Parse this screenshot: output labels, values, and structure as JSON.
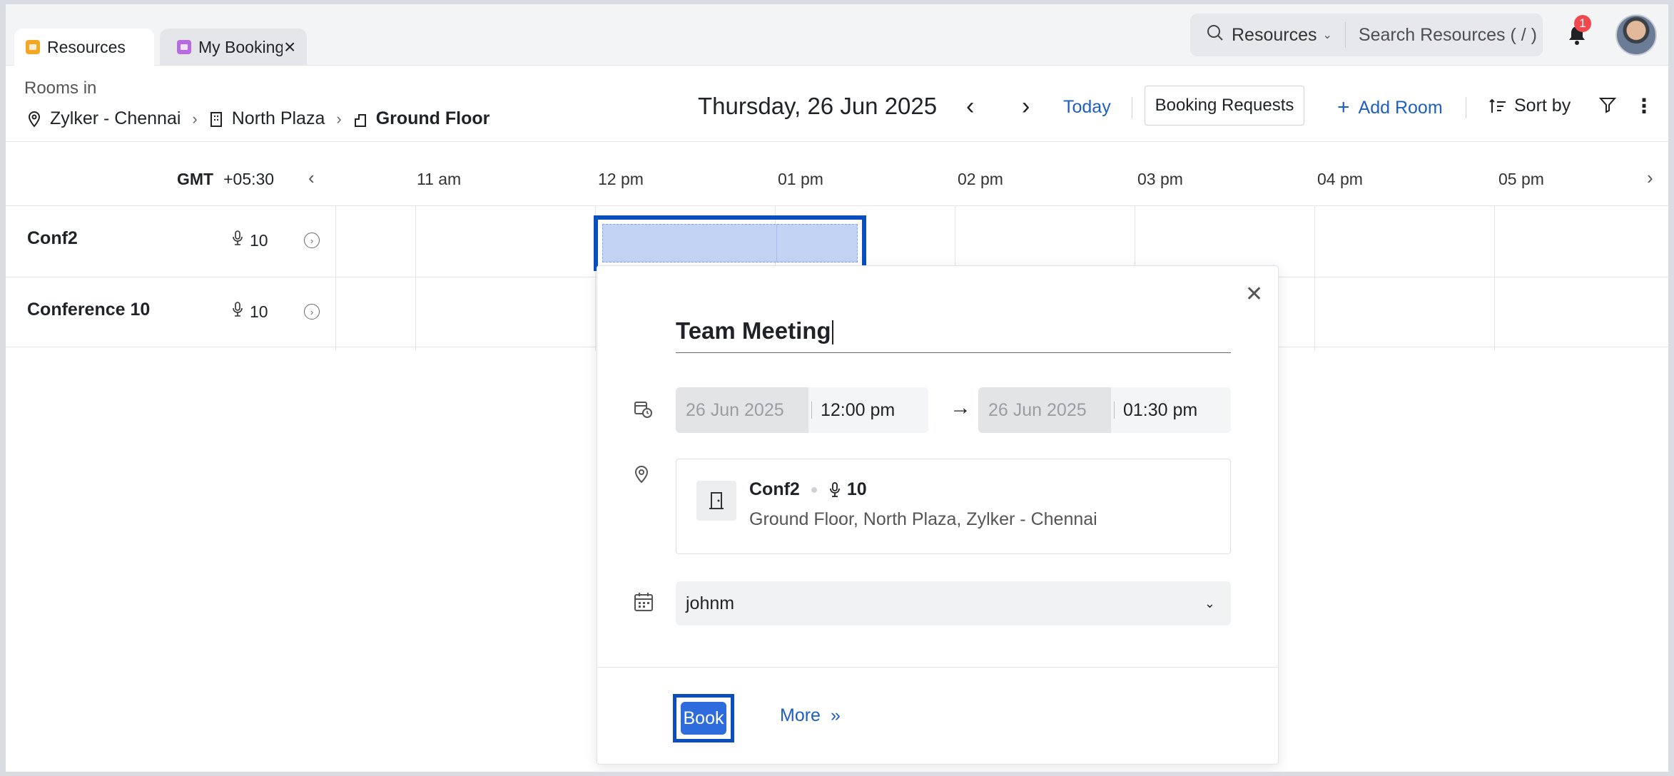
{
  "tabs": [
    {
      "label": "Resources",
      "active": true
    },
    {
      "label": "My Bookings",
      "active": false
    }
  ],
  "search": {
    "scope": "Resources",
    "placeholder": "Search Resources ( / )"
  },
  "notifications": {
    "count": "1"
  },
  "header": {
    "rooms_in": "Rooms in",
    "breadcrumb": [
      "Zylker - Chennai",
      "North Plaza",
      "Ground Floor"
    ],
    "date_title": "Thursday, 26 Jun 2025",
    "today": "Today",
    "booking_requests": "Booking Requests",
    "add_room": "Add Room",
    "sort_by": "Sort by"
  },
  "timeline": {
    "gmt_label": "GMT",
    "gmt_offset": "+05:30",
    "hours": [
      "11 am",
      "12 pm",
      "01 pm",
      "02 pm",
      "03 pm",
      "04 pm",
      "05 pm"
    ]
  },
  "rooms": [
    {
      "name": "Conf2",
      "capacity": "10"
    },
    {
      "name": "Conference 10",
      "capacity": "10"
    }
  ],
  "booking_popup": {
    "title": "Team Meeting",
    "start_date": "26 Jun 2025",
    "start_time": "12:00 pm",
    "end_date": "26 Jun 2025",
    "end_time": "01:30 pm",
    "room_name": "Conf2",
    "room_capacity": "10",
    "room_address": "Ground Floor, North Plaza, Zylker - Chennai",
    "calendar": "johnm",
    "book_label": "Book",
    "more_label": "More"
  },
  "colors": {
    "accent": "#2e6bdc",
    "link": "#1f5fbf",
    "highlight": "#0b4fbf",
    "selection_fill": "#c3d3f3"
  }
}
